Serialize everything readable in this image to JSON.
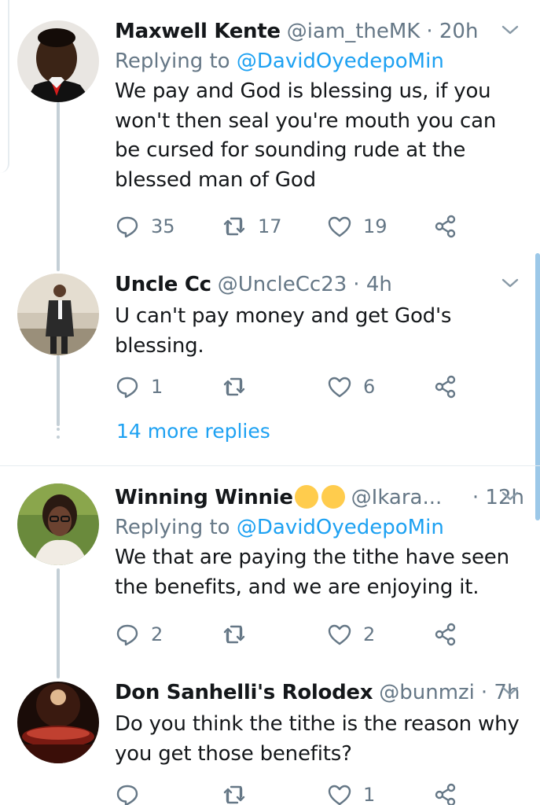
{
  "colors": {
    "accent": "#1da1f2",
    "muted": "#657786",
    "text": "#14171a",
    "divider": "#e6ecf0"
  },
  "tweets": [
    {
      "name": "Maxwell Kente",
      "handle": "@iam_theMK",
      "time": "· 20h",
      "replying_label": "Replying to",
      "replying_to": "@DavidOyedepoMin",
      "text": "We pay and God is blessing us, if you won't then seal you're mouth you can be cursed for sounding rude at the blessed man of God",
      "replies": "35",
      "retweets": "17",
      "likes": "19"
    },
    {
      "name": "Uncle Cc",
      "handle": "@UncleCc23",
      "time": "· 4h",
      "text": "U can't pay money and get God's blessing.",
      "replies": "1",
      "retweets": "",
      "likes": "6"
    },
    {
      "name": "Winning Winnie",
      "name_emojis": "😘😘",
      "handle": "@Ikara...",
      "time": "· 12h",
      "replying_label": "Replying to",
      "replying_to": "@DavidOyedepoMin",
      "text": "We that are paying the tithe have seen the benefits, and we are enjoying it.",
      "replies": "2",
      "retweets": "",
      "likes": "2"
    },
    {
      "name": "Don Sanhelli's Rolodex",
      "handle": "@bunmzi",
      "time": "· 7h",
      "text": "Do you think the tithe is the reason why you get those benefits?",
      "replies": "",
      "retweets": "",
      "likes": "1"
    }
  ],
  "more_replies": "14 more replies",
  "icons": [
    "reply-icon",
    "retweet-icon",
    "like-icon",
    "share-icon",
    "chevron-down-icon"
  ]
}
